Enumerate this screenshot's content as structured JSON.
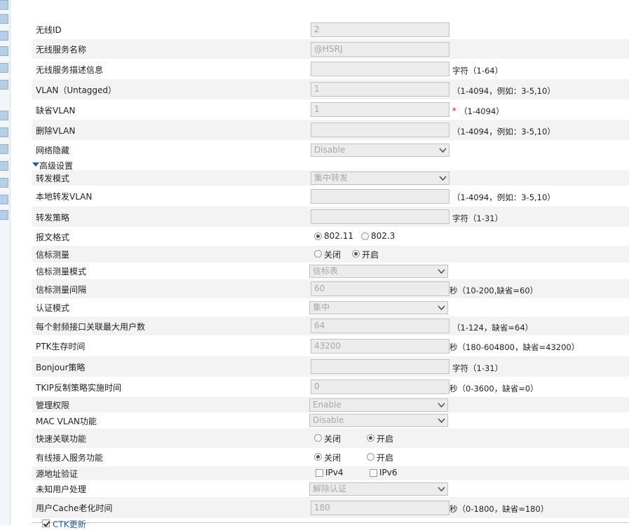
{
  "rows": [
    {
      "label": "无线ID",
      "value": "2"
    },
    {
      "label": "无线服务名称",
      "value": "@HSRJ"
    },
    {
      "label": "无线服务描述信息",
      "value": "",
      "hint": "字符（1-64）"
    },
    {
      "label": "VLAN（Untagged）",
      "value": "1",
      "hint": "（1-4094，例如：3-5,10）"
    },
    {
      "label": "缺省VLAN",
      "value": "1",
      "required": "*",
      "hint": "（1-4094）"
    },
    {
      "label": "删除VLAN",
      "value": "",
      "hint": "（1-4094，例如：3-5,10）"
    },
    {
      "label": "网络隐藏",
      "selected": "Disable"
    },
    {
      "label": "转发模式",
      "selected": "集中转发"
    },
    {
      "label": "本地转发VLAN",
      "value": "",
      "hint": "（1-4094，例如：3-5,10）"
    },
    {
      "label": "转发策略",
      "value": "",
      "hint": "字符（1-31）"
    },
    {
      "label": "报文格式",
      "options": [
        "802.11",
        "802.3"
      ],
      "checked": 0
    },
    {
      "label": "信标测量",
      "options": [
        "关闭",
        "开启"
      ],
      "checked": 1
    },
    {
      "label": "信标测量模式",
      "selected": "信标表"
    },
    {
      "label": "信标测量间隔",
      "value": "60",
      "hint": "秒（10-200,缺省=60）"
    },
    {
      "label": "认证模式",
      "selected": "集中"
    },
    {
      "label": "每个射频接口关联最大用户数",
      "value": "64",
      "hint": "（1-124，缺省=64）"
    },
    {
      "label": "PTK生存时间",
      "value": "43200",
      "hint": "秒（180-604800，缺省=43200）"
    },
    {
      "label": "Bonjour策略",
      "value": "",
      "hint": "字符（1-31）"
    },
    {
      "label": "TKIP反制策略实施时间",
      "value": "0",
      "hint": "秒（0-3600，缺省=0）"
    },
    {
      "label": "管理权限",
      "selected": "Enable"
    },
    {
      "label": "MAC VLAN功能",
      "selected": "Disable"
    },
    {
      "label": "快速关联功能",
      "options": [
        "关闭",
        "开启"
      ],
      "checked": 1
    },
    {
      "label": "有线接入服务功能",
      "options": [
        "关闭",
        "开启"
      ],
      "checked": 0
    },
    {
      "label": "源地址验证",
      "options": [
        "IPv4",
        "IPv6"
      ],
      "checked": -1
    },
    {
      "label": "未知用户处理",
      "selected": "解除认证"
    },
    {
      "label": "用户Cache老化时间",
      "value": "180",
      "hint": "秒（0-1800，缺省=180）"
    }
  ],
  "advanced": {
    "label": "高级设置"
  },
  "footer": {
    "ctk_label": "CTK更新"
  }
}
